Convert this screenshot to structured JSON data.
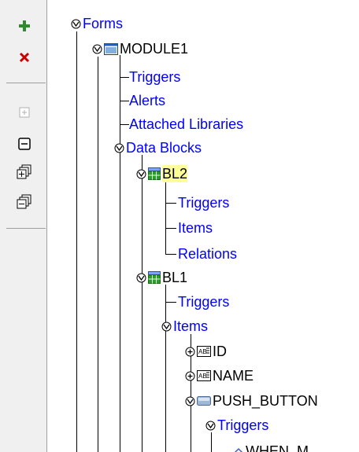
{
  "toolbar": {
    "items": [
      {
        "name": "add-icon",
        "symbol": "+",
        "color": "#2e8b2e"
      },
      {
        "name": "delete-icon",
        "symbol": "×",
        "color": "#cc0000"
      },
      {
        "name": "expand-icon"
      },
      {
        "name": "collapse-icon"
      },
      {
        "name": "expand-all-icon"
      },
      {
        "name": "collapse-all-icon"
      }
    ]
  },
  "tree": {
    "forms": "Forms",
    "module": "MODULE1",
    "triggers_form": "Triggers",
    "alerts": "Alerts",
    "attached_libraries": "Attached Libraries",
    "data_blocks": "Data Blocks",
    "bl2": "BL2",
    "bl2_triggers": "Triggers",
    "bl2_items": "Items",
    "bl2_relations": "Relations",
    "bl1": "BL1",
    "bl1_triggers": "Triggers",
    "bl1_items": "Items",
    "item_id": "ID",
    "item_name": "NAME",
    "item_push_button": "PUSH_BUTTON",
    "pb_triggers": "Triggers",
    "when_trigger": "WHEN_M"
  },
  "colors": {
    "link": "#0000ff",
    "selected_bg": "#ffff99"
  }
}
